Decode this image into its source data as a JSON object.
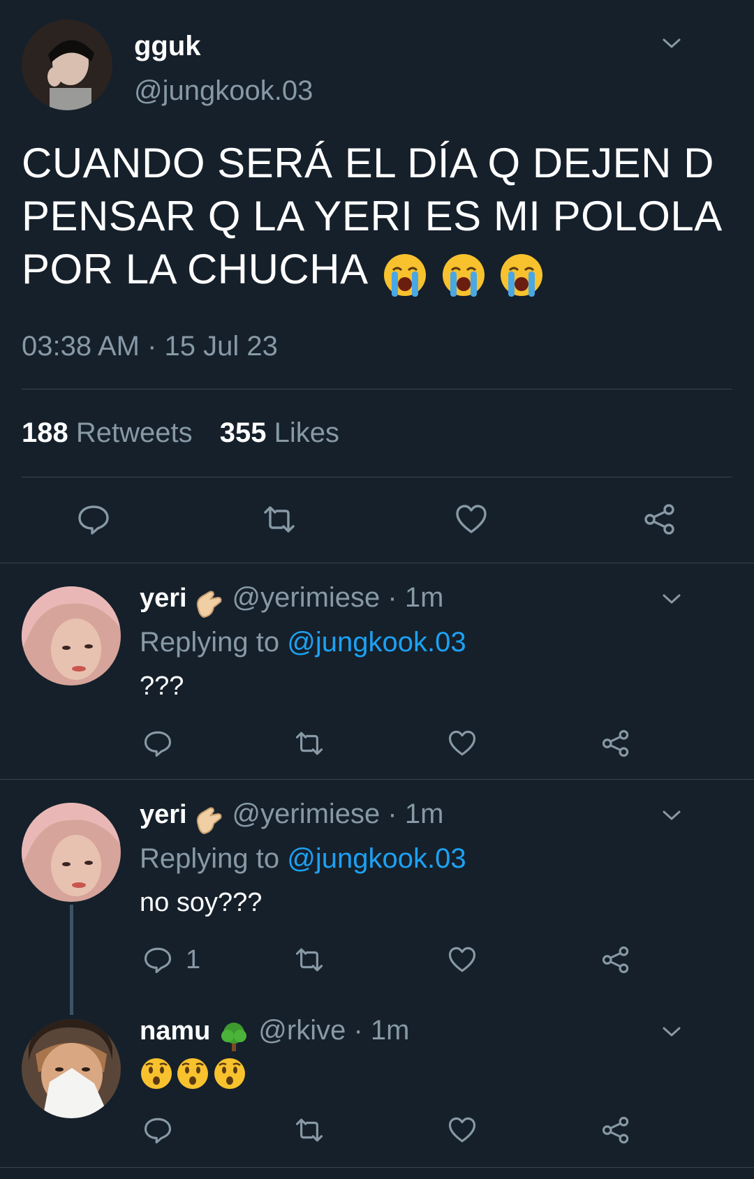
{
  "tweet": {
    "display_name": "gguk",
    "handle": "@jungkook.03",
    "text": "CUANDO SERÁ EL DÍA Q DEJEN D PENSAR Q LA YERI ES MI POLOLA POR LA CHUCHA",
    "emoji": [
      "loudly-crying-face",
      "loudly-crying-face",
      "loudly-crying-face"
    ],
    "timestamp": "03:38 AM · 15 Jul 23",
    "retweets_count": "188",
    "retweets_label": "Retweets",
    "likes_count": "355",
    "likes_label": "Likes"
  },
  "replies": [
    {
      "display_name": "yeri",
      "badge_icon": "pinching-hand-emoji",
      "handle_time": "@yerimiese · 1m",
      "replying_prefix": "Replying to",
      "replying_handle": "@jungkook.03",
      "text": "???",
      "reply_count": ""
    },
    {
      "display_name": "yeri",
      "badge_icon": "pinching-hand-emoji",
      "handle_time": "@yerimiese · 1m",
      "replying_prefix": "Replying to",
      "replying_handle": "@jungkook.03",
      "text": "no soy???",
      "reply_count": "1"
    },
    {
      "display_name": "namu",
      "badge_icon": "tree-emoji",
      "handle_time": "@rkive · 1m",
      "text_emoji": [
        "hushed-face",
        "hushed-face",
        "hushed-face"
      ],
      "reply_count": ""
    }
  ],
  "colors": {
    "background": "#15202b",
    "secondary_text": "#8899a6",
    "link": "#1da1f2",
    "divider": "#38444d"
  }
}
